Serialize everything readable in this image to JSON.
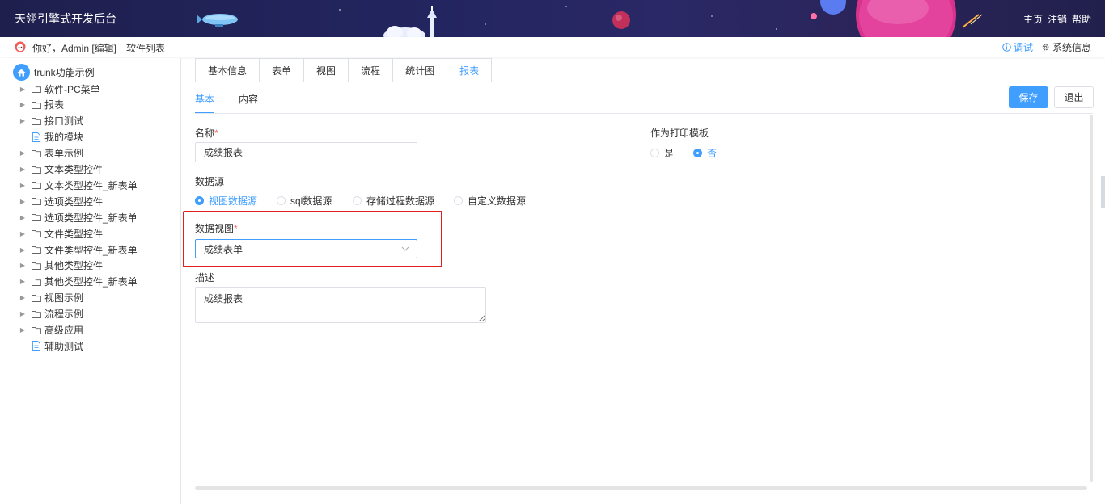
{
  "header": {
    "app_title": "天翎引擎式开发后台",
    "links": [
      "主页",
      "注销",
      "帮助"
    ]
  },
  "subbar": {
    "greeting": "你好，Admin [编辑]",
    "software_list": "软件列表",
    "debug": "调试",
    "system_info": "系统信息"
  },
  "sidebar": {
    "root": "trunk功能示例",
    "items": [
      {
        "label": "软件-PC菜单",
        "type": "folder"
      },
      {
        "label": "报表",
        "type": "folder"
      },
      {
        "label": "接口测试",
        "type": "folder"
      },
      {
        "label": "我的模块",
        "type": "file"
      },
      {
        "label": "表单示例",
        "type": "folder"
      },
      {
        "label": "文本类型控件",
        "type": "folder"
      },
      {
        "label": "文本类型控件_新表单",
        "type": "folder"
      },
      {
        "label": "选项类型控件",
        "type": "folder"
      },
      {
        "label": "选项类型控件_新表单",
        "type": "folder"
      },
      {
        "label": "文件类型控件",
        "type": "folder"
      },
      {
        "label": "文件类型控件_新表单",
        "type": "folder"
      },
      {
        "label": "其他类型控件",
        "type": "folder"
      },
      {
        "label": "其他类型控件_新表单",
        "type": "folder"
      },
      {
        "label": "视图示例",
        "type": "folder"
      },
      {
        "label": "流程示例",
        "type": "folder"
      },
      {
        "label": "高级应用",
        "type": "folder"
      },
      {
        "label": "辅助测试",
        "type": "file"
      }
    ]
  },
  "main": {
    "tabs": [
      "基本信息",
      "表单",
      "视图",
      "流程",
      "统计图",
      "报表"
    ],
    "active_tab": "报表",
    "subtabs": [
      "基本",
      "内容"
    ],
    "active_subtab": "基本",
    "save_label": "保存",
    "exit_label": "退出",
    "form": {
      "name_label": "名称",
      "name_value": "成绩报表",
      "print_template_label": "作为打印模板",
      "print_template_options": [
        "是",
        "否"
      ],
      "print_template_selected": "否",
      "datasource_label": "数据源",
      "datasource_options": [
        "视图数据源",
        "sql数据源",
        "存储过程数据源",
        "自定义数据源"
      ],
      "datasource_selected": "视图数据源",
      "dataview_label": "数据视图",
      "dataview_value": "成绩表单",
      "desc_label": "描述",
      "desc_value": "成绩报表"
    }
  },
  "colors": {
    "accent": "#409eff",
    "highlight_border": "#e02020",
    "header_bg": "#232560"
  }
}
